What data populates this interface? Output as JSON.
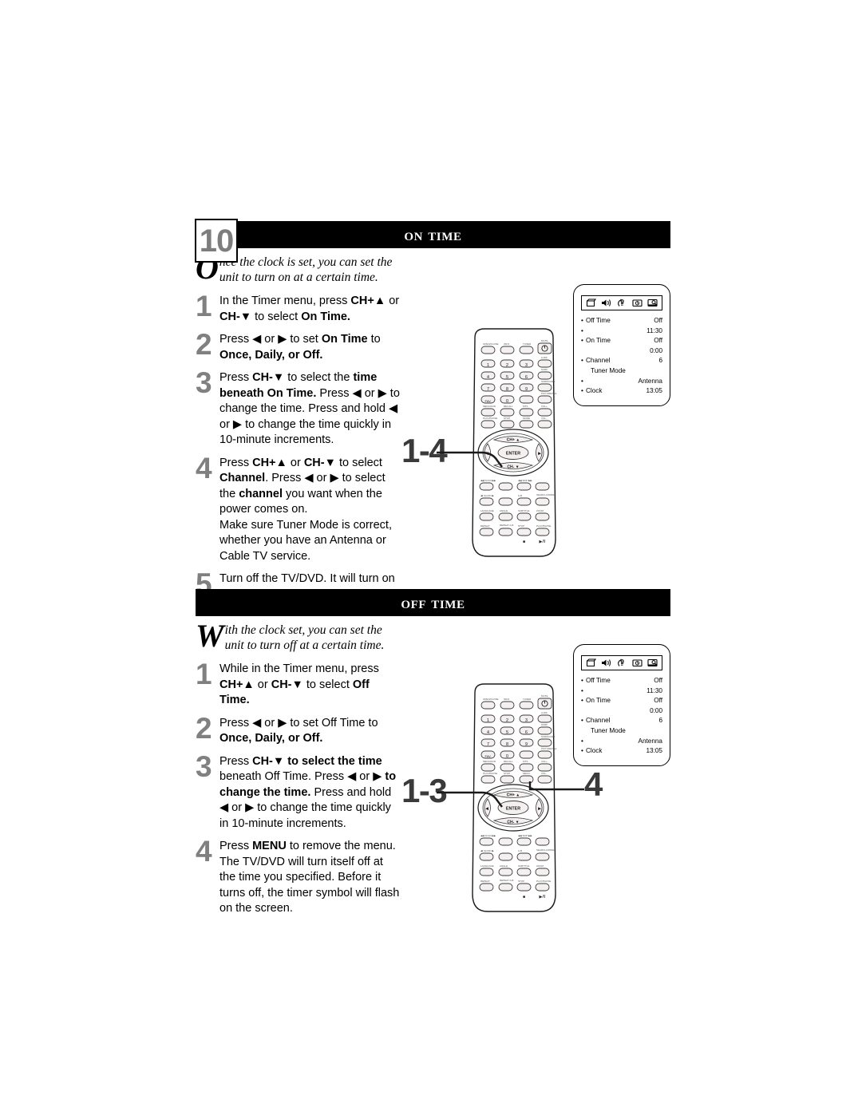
{
  "page": {
    "sections": [
      {
        "badge": "10",
        "title": "On Time",
        "intro_cap": "O",
        "intro_text": "nce the clock is set, you can set the unit to turn on at a certain time.",
        "steps": [
          {
            "num": "1",
            "html": "In the Timer menu, press <b>CH+&#9650;</b> or <b>CH-&#9660;</b> to select <b>On Time.</b>"
          },
          {
            "num": "2",
            "html": "Press &#9664; or &#9654; to set <b>On Time</b> to <b>Once, Daily, or Off.</b>"
          },
          {
            "num": "3",
            "html": "Press <b>CH-&#9660;</b> to select the <b>time beneath On Time.</b> Press &#9664; or &#9654; to change the time. Press and hold &#9664; or &#9654; to change the time quickly in 10-minute increments."
          },
          {
            "num": "4",
            "html": "Press <b>CH+&#9650;</b> or <b>CH-&#9660;</b> to select <b>Channel</b>. Press &#9664; or &#9654; to select the <b>channel</b> you want when the power comes on.<br>Make sure Tuner Mode is correct, whether you have an Antenna or Cable TV service."
          },
          {
            "num": "5",
            "html": "Turn off the TV/DVD. It will turn on at the time you set."
          }
        ],
        "callouts": [
          {
            "label": "1-4"
          }
        ]
      },
      {
        "badge": "",
        "title": "Off Time",
        "intro_cap": "W",
        "intro_text": "ith the clock set, you can set the unit to turn off at a certain time.",
        "steps": [
          {
            "num": "1",
            "html": "While in the Timer menu, press <b>CH+&#9650;</b> or <b>CH-&#9660;</b> to select <b>Off Time.</b>"
          },
          {
            "num": "2",
            "html": "Press &#9664; or &#9654; to set Off Time to <b>Once, Daily, or Off.</b>"
          },
          {
            "num": "3",
            "html": "Press <b>CH-&#9660; to select the time</b> beneath Off Time. Press &#9664; or &#9654; <b>to change the time.</b> Press and hold &#9664; or &#9654; to change the time quickly in 10-minute increments."
          },
          {
            "num": "4",
            "html": "Press <b>MENU</b> to remove the menu. The TV/DVD will turn itself off at the time you specified. Before it turns off, the timer symbol will flash on the screen."
          }
        ],
        "callouts": [
          {
            "label": "1-3"
          },
          {
            "label": "4"
          }
        ]
      }
    ]
  },
  "tv_menu": {
    "icons": [
      "picture-icon",
      "sound-icon",
      "features-icon",
      "timer-icon",
      "install-icon"
    ],
    "rows": [
      {
        "bullet": "•",
        "label": "Off Time",
        "value": "Off",
        "indent": false
      },
      {
        "bullet": "•",
        "label": "",
        "value": "11:30",
        "indent": false
      },
      {
        "bullet": "•",
        "label": "On Time",
        "value": "Off",
        "indent": false
      },
      {
        "bullet": "",
        "label": "",
        "value": "0:00",
        "indent": false
      },
      {
        "bullet": "•",
        "label": "Channel",
        "value": "6",
        "indent": false
      },
      {
        "bullet": "",
        "label": "Tuner Mode",
        "value": "",
        "indent": true
      },
      {
        "bullet": "•",
        "label": "",
        "value": "Antenna",
        "indent": false
      },
      {
        "bullet": "•",
        "label": "Clock",
        "value": "13:05",
        "indent": false
      }
    ]
  },
  "remote": {
    "keypad_digits": [
      "1",
      "2",
      "3",
      "4",
      "5",
      "6",
      "7",
      "8",
      "9",
      "0"
    ],
    "nav": {
      "up": "CH+ ▲",
      "down": "CH- ▼",
      "center": "ENTER"
    },
    "transport": {
      "stop": "■",
      "play_pause": "▶/II"
    },
    "colors": {
      "outline": "#1a1a1a",
      "button_fill": "#f4f0f0"
    }
  },
  "colors": {
    "header_bar": "#000000",
    "header_text": "#ffffff",
    "step_number": "#808080",
    "badge_number": "#7d7d7d",
    "callout": "#3a3a3a",
    "page_bg": "#ffffff"
  }
}
